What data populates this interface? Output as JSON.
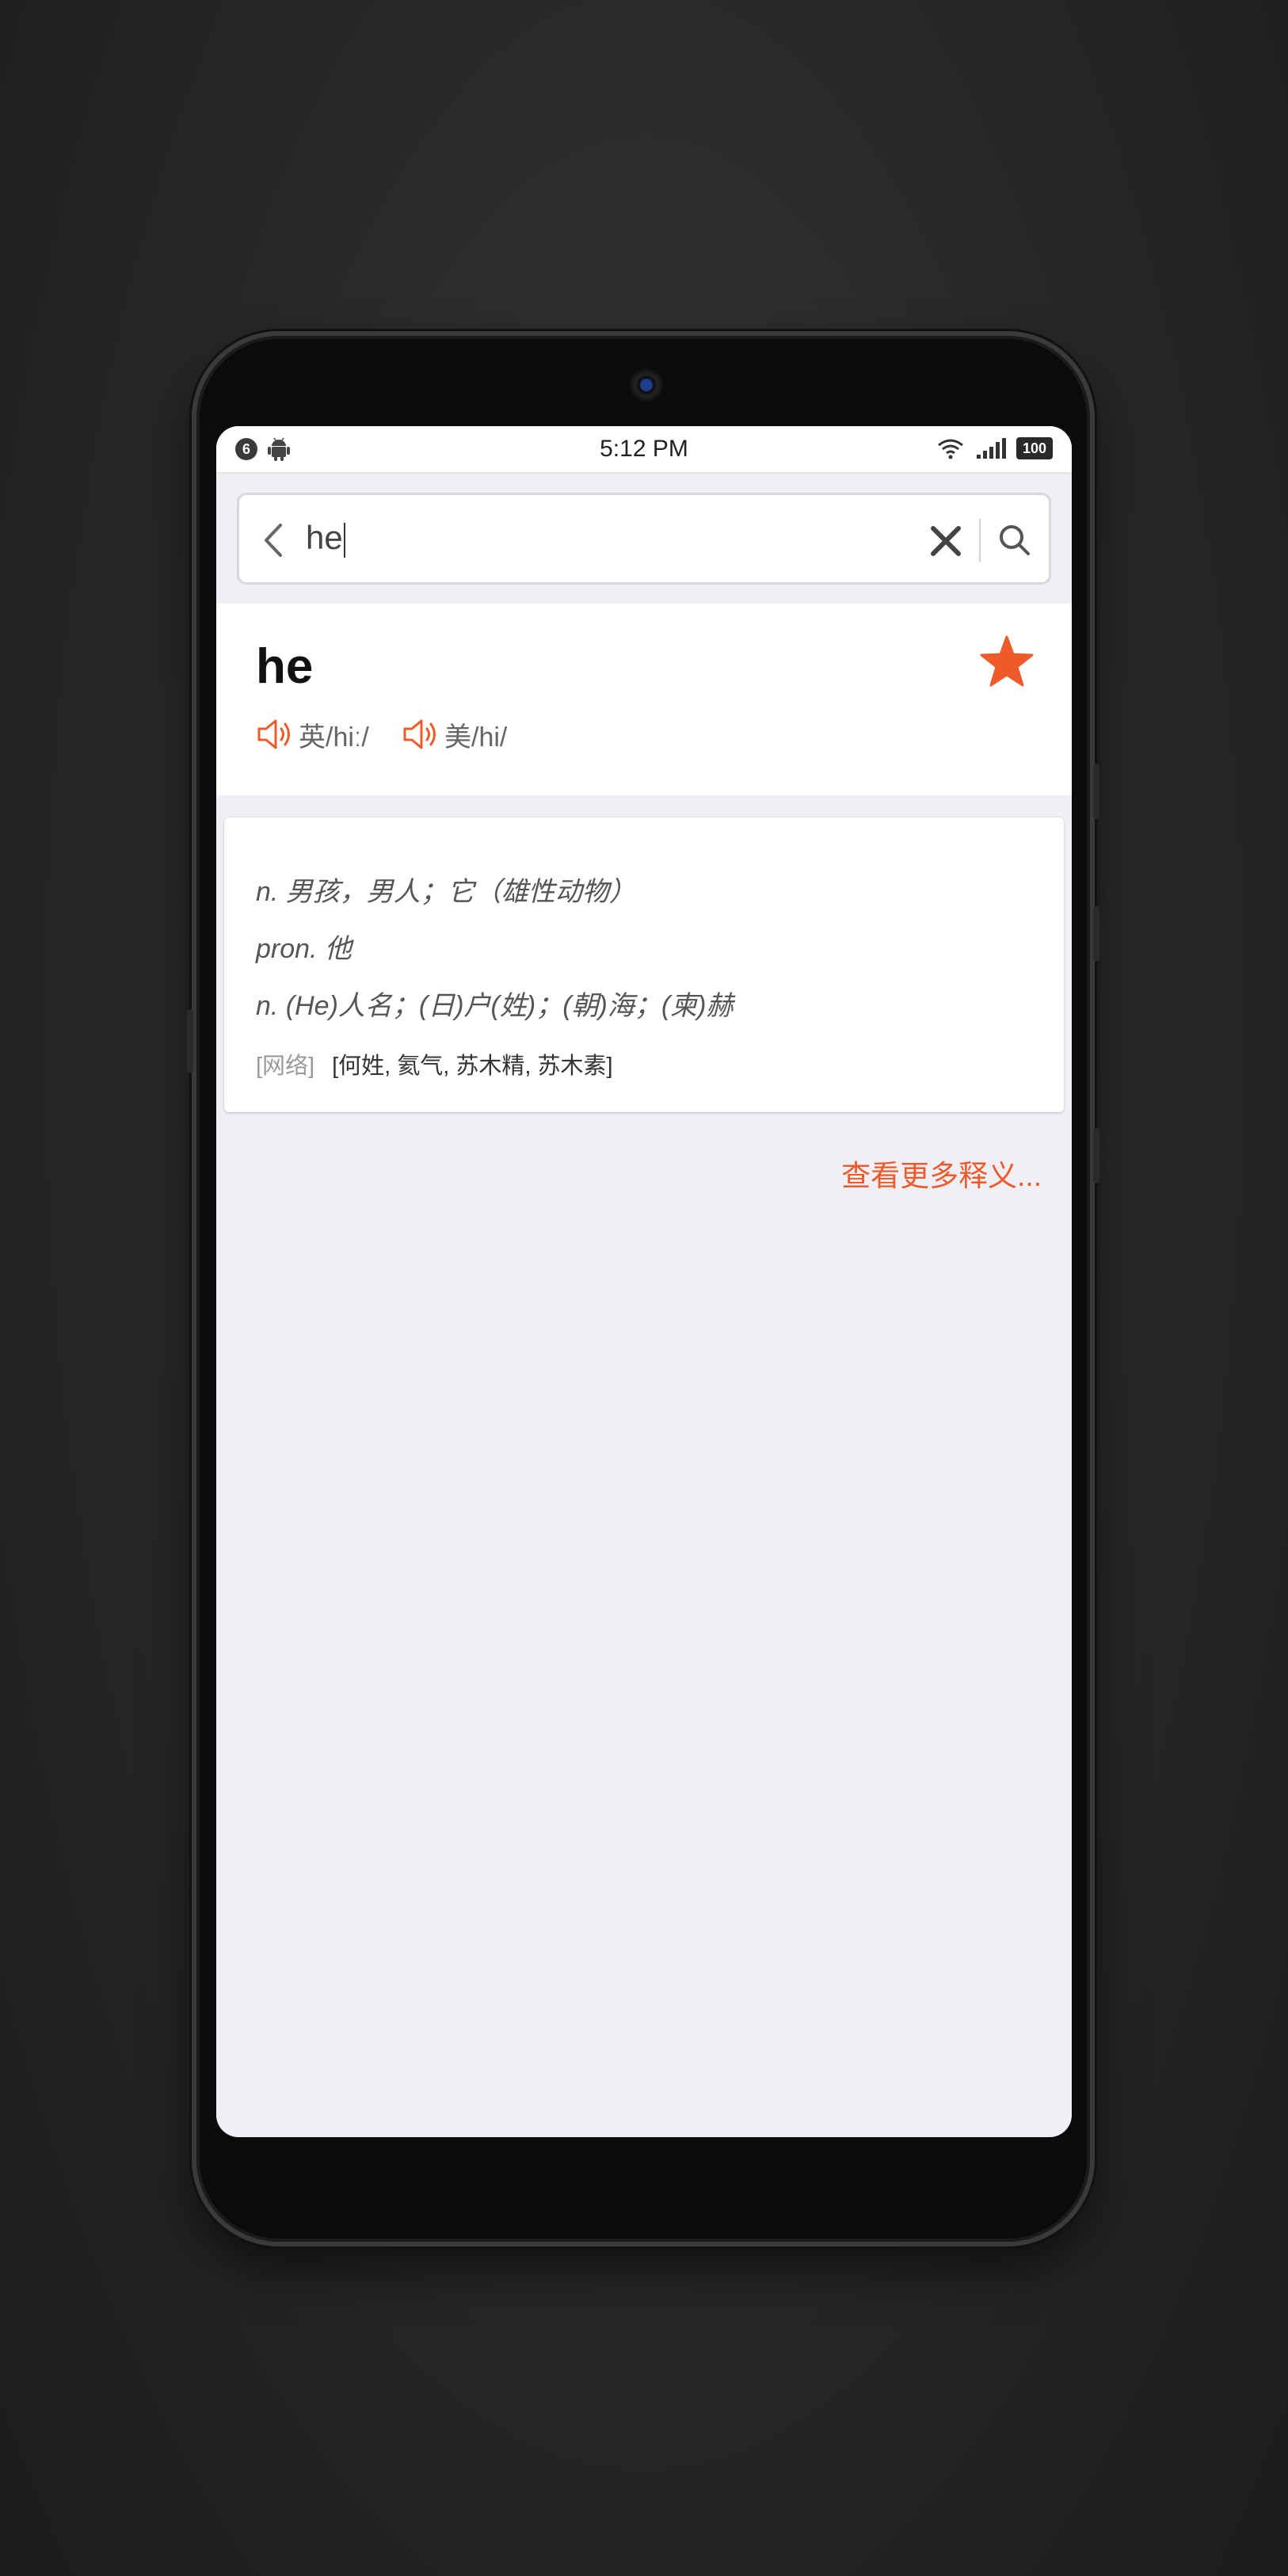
{
  "status_bar": {
    "notification_count": "6",
    "time": "5:12 PM",
    "battery": "100"
  },
  "search": {
    "query": "he"
  },
  "entry": {
    "word": "he",
    "uk_label": "英/hiː/",
    "us_label": "美/hi/",
    "definitions": [
      "n. 男孩，男人；它（雄性动物）",
      "pron. 他",
      "n. (He)人名；(日)户(姓)；(朝)海；(柬)赫"
    ],
    "web_tag": "[网络]",
    "web_meanings": "[何姓, 氦气, 苏木精, 苏木素]",
    "more_link": "查看更多释义..."
  },
  "colors": {
    "accent": "#ef5a2a",
    "background": "#efeff5"
  }
}
